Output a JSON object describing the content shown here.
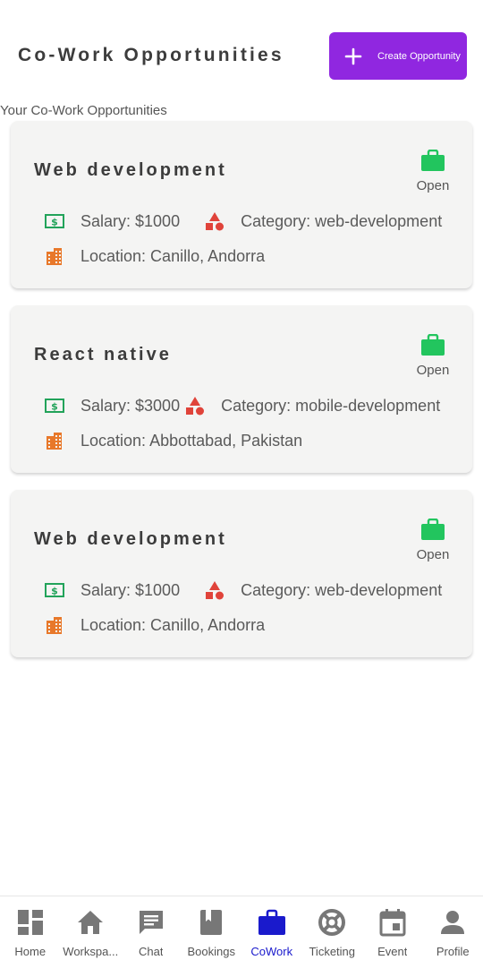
{
  "header": {
    "title": "Co-Work Opportunities",
    "create_label": "Create Opportunity"
  },
  "section_label": "Your Co-Work Opportunities",
  "opportunities": [
    {
      "title": "Web development",
      "status": "Open",
      "salary": "Salary: $1000",
      "category": "Category: web-development",
      "location": "Location: Canillo, Andorra"
    },
    {
      "title": "React native",
      "status": "Open",
      "salary": "Salary: $3000",
      "category": "Category: mobile-development",
      "location": "Location: Abbottabad, Pakistan"
    },
    {
      "title": "Web development",
      "status": "Open",
      "salary": "Salary: $1000",
      "category": "Category: web-development",
      "location": "Location: Canillo, Andorra"
    }
  ],
  "nav": [
    {
      "label": "Home",
      "icon": "dashboard-icon"
    },
    {
      "label": "Workspa...",
      "icon": "home-icon"
    },
    {
      "label": "Chat",
      "icon": "chat-icon"
    },
    {
      "label": "Bookings",
      "icon": "book-icon"
    },
    {
      "label": "CoWork",
      "icon": "briefcase-icon",
      "active": true
    },
    {
      "label": "Ticketing",
      "icon": "lifebuoy-icon"
    },
    {
      "label": "Event",
      "icon": "calendar-icon"
    },
    {
      "label": "Profile",
      "icon": "person-icon"
    }
  ],
  "colors": {
    "accent": "#9027e0",
    "status_green": "#22c55e",
    "salary_green": "#22a35a",
    "category_red": "#e0433a",
    "location_orange": "#e8782a",
    "nav_active": "#1a1acc",
    "nav_inactive": "#777777"
  }
}
